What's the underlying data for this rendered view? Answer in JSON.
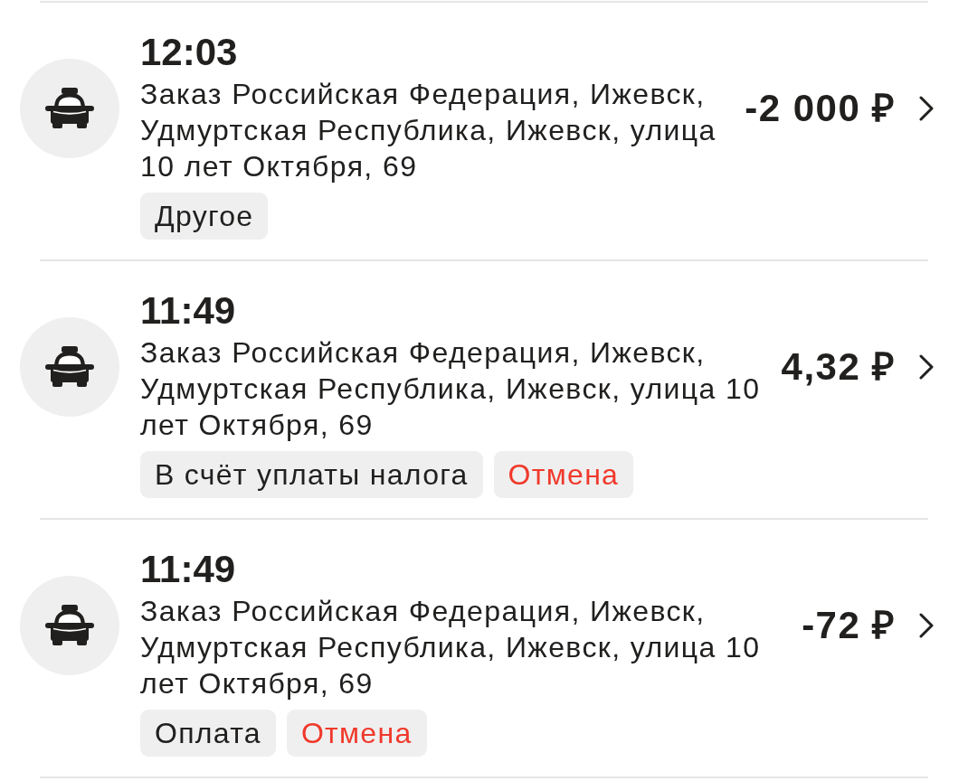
{
  "transactions": [
    {
      "time": "12:03",
      "description": "Заказ Российская Федерация, Ижевск, Удмуртская Республика, Ижевск, улица 10 лет Октября, 69",
      "amount": "-2 000 ₽",
      "tags": [
        {
          "label": "Другое",
          "kind": "category"
        }
      ]
    },
    {
      "time": "11:49",
      "description": "Заказ Российская Федерация, Ижевск, Удмуртская Республика, Ижевск, улица 10 лет Октября, 69",
      "amount": "4,32 ₽",
      "tags": [
        {
          "label": "В счёт уплаты налога",
          "kind": "category"
        },
        {
          "label": "Отмена",
          "kind": "cancelled"
        }
      ]
    },
    {
      "time": "11:49",
      "description": "Заказ Российская Федерация, Ижевск, Удмуртская Республика, Ижевск, улица 10 лет Октября, 69",
      "amount": "-72 ₽",
      "tags": [
        {
          "label": "Оплата",
          "kind": "category"
        },
        {
          "label": "Отмена",
          "kind": "cancelled"
        }
      ]
    }
  ]
}
